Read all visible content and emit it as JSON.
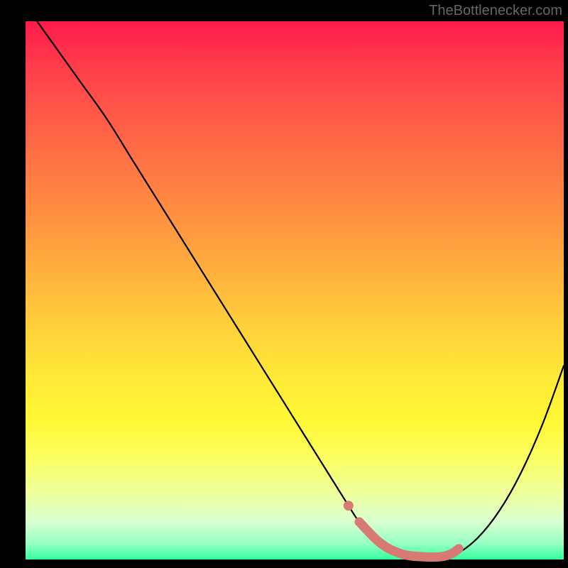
{
  "attribution": "TheBottlenecker.com",
  "chart_data": {
    "type": "line",
    "title": "",
    "xlabel": "",
    "ylabel": "",
    "xlim": [
      0,
      100
    ],
    "ylim": [
      0,
      100
    ],
    "series": [
      {
        "name": "bottleneck-curve",
        "x": [
          0,
          5,
          10,
          15,
          20,
          25,
          30,
          35,
          40,
          45,
          50,
          55,
          60,
          62,
          64,
          66,
          70,
          74,
          77,
          80,
          84,
          88,
          92,
          96,
          100
        ],
        "values": [
          103,
          96,
          89,
          82,
          74,
          66,
          58,
          50,
          42,
          34,
          26,
          18,
          10,
          7,
          5,
          3,
          1,
          0.5,
          0.5,
          1,
          4,
          9,
          16,
          25,
          36
        ]
      }
    ],
    "highlight": {
      "name": "optimal-range",
      "x": [
        62,
        66,
        70,
        74,
        77,
        79,
        80.5
      ],
      "values": [
        7.0,
        3.0,
        1.0,
        0.5,
        0.5,
        1.0,
        2.0
      ]
    },
    "gradient_stops": {
      "top": "#ff1a4d",
      "mid": "#ffe438",
      "bottom": "#32ff9e"
    }
  }
}
